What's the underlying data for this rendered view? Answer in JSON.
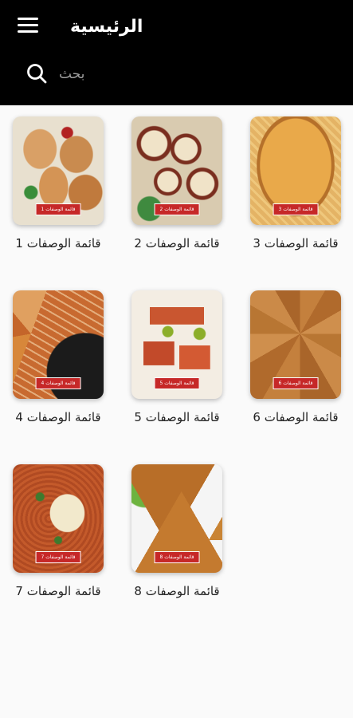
{
  "app_bar": {
    "title": "الرئيسية",
    "menu_icon": "hamburger-menu-icon"
  },
  "search": {
    "icon": "search-icon",
    "placeholder": "بحث",
    "value": ""
  },
  "colors": {
    "app_bar_bg": "#000000",
    "page_bg": "#fafafa",
    "tag_bg": "#c62828"
  },
  "recipe_lists": [
    {
      "label": "قائمة الوصفات 1",
      "tag": "قائمة الوصفات 1"
    },
    {
      "label": "قائمة الوصفات 2",
      "tag": "قائمة الوصفات 2"
    },
    {
      "label": "قائمة الوصفات 3",
      "tag": "قائمة الوصفات 3"
    },
    {
      "label": "قائمة الوصفات 4",
      "tag": "قائمة الوصفات 4"
    },
    {
      "label": "قائمة الوصفات 5",
      "tag": "قائمة الوصفات 5"
    },
    {
      "label": "قائمة الوصفات 6",
      "tag": "قائمة الوصفات 6"
    },
    {
      "label": "قائمة الوصفات 7",
      "tag": "قائمة الوصفات 7"
    },
    {
      "label": "قائمة الوصفات 8",
      "tag": "قائمة الوصفات 8"
    }
  ]
}
